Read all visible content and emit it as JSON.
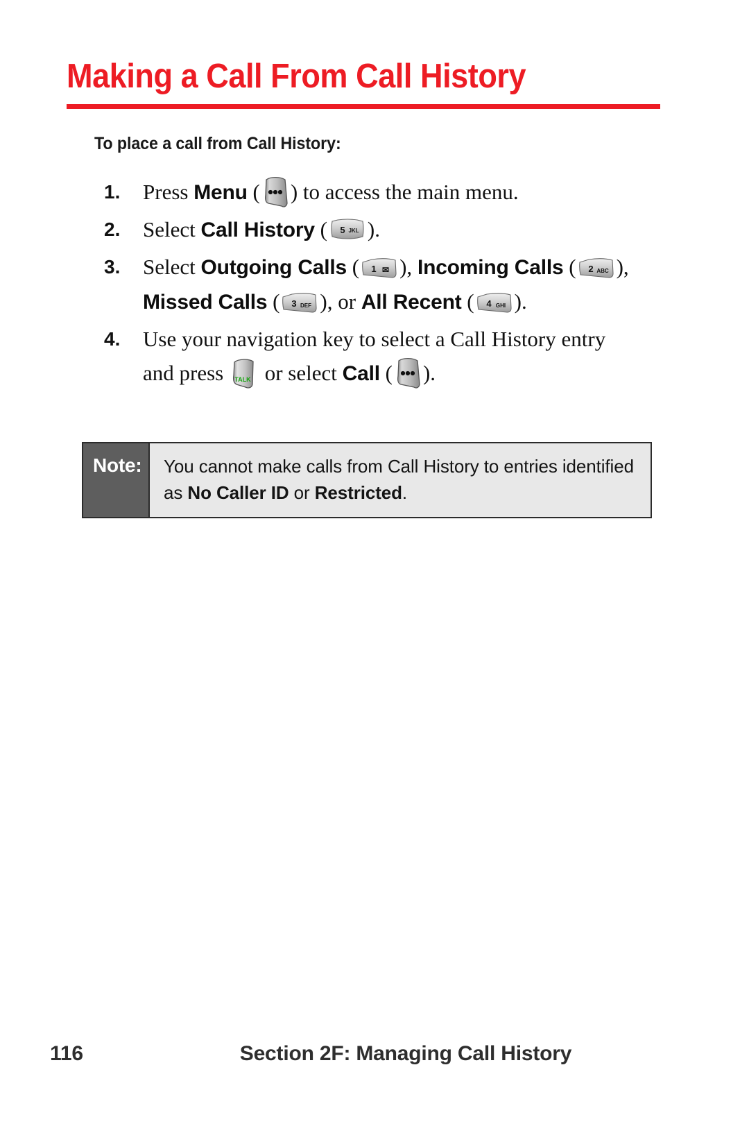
{
  "document": {
    "title": "Making a Call From Call History",
    "subhead": "To place a call from Call History:",
    "accent_color": "#ED1C24",
    "note_label_bg": "#5E5E5E",
    "note_body_bg": "#E8E8E8"
  },
  "steps": [
    {
      "number": "1.",
      "lines": [
        [
          {
            "t": "text",
            "v": "Press "
          },
          {
            "t": "ui",
            "v": "Menu"
          },
          {
            "t": "text",
            "v": " ("
          },
          {
            "t": "key",
            "icon": "softkey-menu-icon",
            "label": "",
            "sub": ""
          },
          {
            "t": "text",
            "v": ") to access the main menu."
          }
        ]
      ]
    },
    {
      "number": "2.",
      "lines": [
        [
          {
            "t": "text",
            "v": "Select "
          },
          {
            "t": "ui",
            "v": "Call History"
          },
          {
            "t": "text",
            "v": " ("
          },
          {
            "t": "key",
            "icon": "key-5-icon",
            "label": "5",
            "sub": "JKL"
          },
          {
            "t": "text",
            "v": ")."
          }
        ]
      ]
    },
    {
      "number": "3.",
      "lines": [
        [
          {
            "t": "text",
            "v": "Select "
          },
          {
            "t": "ui",
            "v": "Outgoing Calls"
          },
          {
            "t": "text",
            "v": " ("
          },
          {
            "t": "key",
            "icon": "key-1-icon",
            "label": "1",
            "sub": "✉"
          },
          {
            "t": "text",
            "v": "), "
          },
          {
            "t": "ui",
            "v": "Incoming Calls"
          },
          {
            "t": "text",
            "v": " ("
          },
          {
            "t": "key",
            "icon": "key-2-icon",
            "label": "2",
            "sub": "ABC"
          },
          {
            "t": "text",
            "v": "),"
          }
        ],
        [
          {
            "t": "ui",
            "v": "Missed Calls"
          },
          {
            "t": "text",
            "v": " ("
          },
          {
            "t": "key",
            "icon": "key-3-icon",
            "label": "3",
            "sub": "DEF"
          },
          {
            "t": "text",
            "v": "), or "
          },
          {
            "t": "ui",
            "v": "All Recent"
          },
          {
            "t": "text",
            "v": " ("
          },
          {
            "t": "key",
            "icon": "key-4-icon",
            "label": "4",
            "sub": "GHI"
          },
          {
            "t": "text",
            "v": ")."
          }
        ]
      ]
    },
    {
      "number": "4.",
      "lines": [
        [
          {
            "t": "text",
            "v": "Use your navigation key to select a Call History entry"
          }
        ],
        [
          {
            "t": "text",
            "v": "and press "
          },
          {
            "t": "key",
            "icon": "talk-key-icon",
            "label": "TALK",
            "sub": ""
          },
          {
            "t": "text",
            "v": " or select "
          },
          {
            "t": "ui",
            "v": "Call"
          },
          {
            "t": "text",
            "v": " ("
          },
          {
            "t": "key",
            "icon": "softkey-menu-icon",
            "label": "",
            "sub": ""
          },
          {
            "t": "text",
            "v": ")."
          }
        ]
      ]
    }
  ],
  "note": {
    "label": "Note:",
    "lines": [
      [
        {
          "t": "text",
          "v": "You cannot make calls from Call History to entries identified"
        }
      ],
      [
        {
          "t": "text",
          "v": "as "
        },
        {
          "t": "bold",
          "v": "No Caller ID"
        },
        {
          "t": "text",
          "v": " or "
        },
        {
          "t": "bold",
          "v": "Restricted"
        },
        {
          "t": "text",
          "v": "."
        }
      ]
    ]
  },
  "footer": {
    "page_number": "116",
    "running_head": "Section 2F: Managing Call History"
  }
}
